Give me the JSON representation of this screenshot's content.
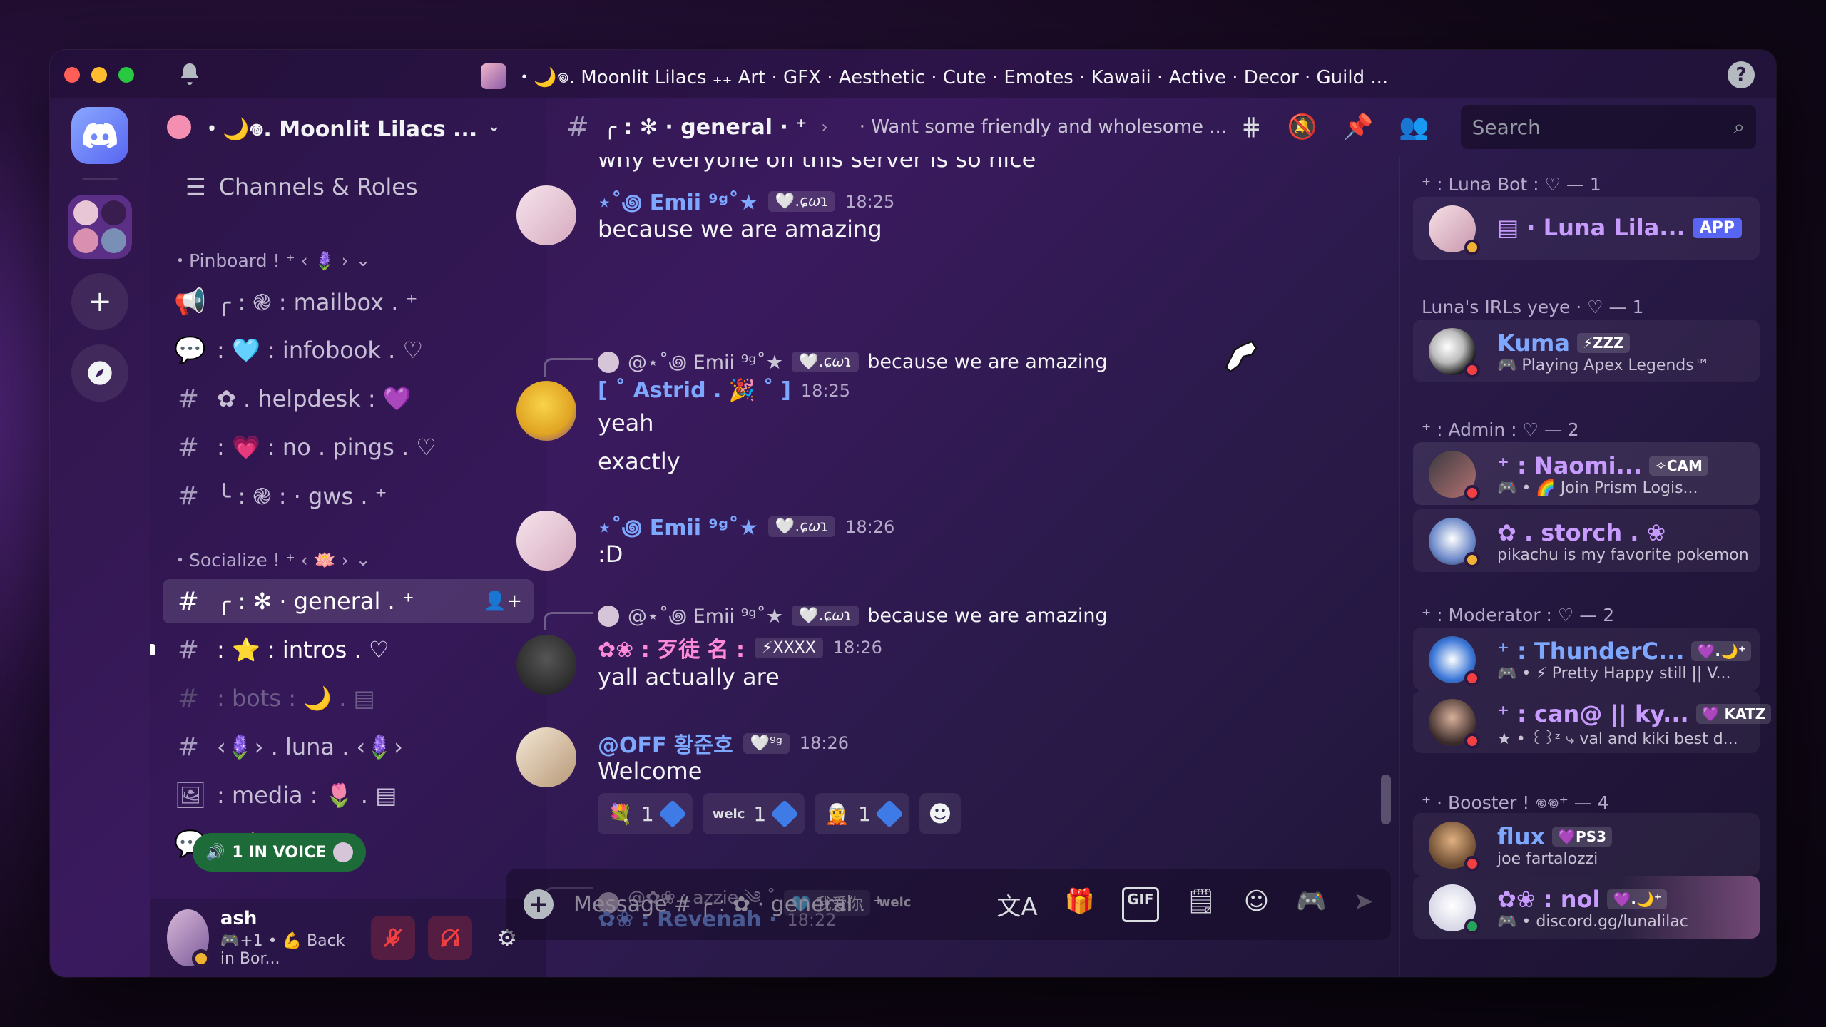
{
  "window": {
    "title": "・🌙𖦹. Moonlit Lilacs ₊₊ Art · GFX · Aesthetic · Cute · Emotes · Kawaii · Active · Decor · Guild ..."
  },
  "server": {
    "name": "・🌙𖦹. Moonlit Lilacs ..."
  },
  "sidebar": {
    "channels_roles": "Channels & Roles",
    "categories": {
      "pinboard": "・Pinboard ! ⁺ ‹ 🪻 ›",
      "socialize": "・Socialize ! ⁺ ‹ 🪷 ›"
    },
    "channels": [
      {
        "hash": "📢",
        "name": "╭ : ֎ : mailbox . ⁺",
        "right": ""
      },
      {
        "hash": "💬",
        "name": ": 🩵 : infobook . ♡",
        "right": ""
      },
      {
        "hash": "#",
        "name": "✿ . helpdesk : 💜",
        "right": ""
      },
      {
        "hash": "#",
        "name": ": 💗 : no . pings . ♡",
        "right": ""
      },
      {
        "hash": "#",
        "name": "╰ : ֎ : · gws . ⁺",
        "right": ""
      },
      {
        "hash": "#",
        "name": "╭ : ✻ · general . ⁺",
        "right": "👤+"
      },
      {
        "hash": "#",
        "name": ": ⭐ : intros . ♡",
        "right": ""
      },
      {
        "hash": "#",
        "name": ": bots : 🌙 . ▤",
        "right": ""
      },
      {
        "hash": "#",
        "name": "‹🪻› . luna . ‹🪻›",
        "right": ""
      },
      {
        "hash": "🖼",
        "name": ": media : 🌷 . ▤",
        "right": ""
      },
      {
        "hash": "💬",
        "name": ": 🌙",
        "right": ""
      }
    ],
    "voice_pill": "1 IN VOICE"
  },
  "user_panel": {
    "name": "ash",
    "status": "🎮+1 • 💪 Back in Bor..."
  },
  "chat_header": {
    "channel": "╭ : ✻ · general · ⁺",
    "topic": "· Want some friendly and wholesome ..."
  },
  "search": {
    "placeholder": "Search"
  },
  "messages": {
    "cutoff": "why everyone on this server is so nice",
    "m1": {
      "name": "⋆˚꩜ Emii ⁹ᵍ˚★",
      "tag": "🤍.ɕ𝜔ɿ",
      "time": "18:25",
      "text": "because we are amazing"
    },
    "m2": {
      "reply_name": "@⋆˚꩜ Emii ⁹ᵍ˚★",
      "reply_tag": "🤍.ɕ𝜔ɿ",
      "reply_text": "because we are amazing",
      "name": "[ ˚ Astrid . 🎉 ˚ ]",
      "time": "18:25",
      "line1": "yeah",
      "line2": "exactly"
    },
    "m3": {
      "name": "⋆˚꩜ Emii ⁹ᵍ˚★",
      "tag": "🤍.ɕ𝜔ɿ",
      "time": "18:26",
      "text": ":D"
    },
    "m4": {
      "reply_name": "@⋆˚꩜ Emii ⁹ᵍ˚★",
      "reply_tag": "🤍.ɕ𝜔ɿ",
      "reply_text": "because we are amazing",
      "name": "✿❀ : 歹徒 名 :",
      "tag": "⚡XXXX",
      "time": "18:26",
      "text": "yall actually are"
    },
    "m5": {
      "name": "@OFF 황준호",
      "tag": "🤍⁹ᵍ",
      "time": "18:26",
      "text": "Welcome",
      "reactions": [
        {
          "emoji": "💐",
          "count": "1"
        },
        {
          "emoji": "welc",
          "count": "1"
        },
        {
          "emoji": "🧝",
          "count": "1"
        }
      ]
    },
    "m6": {
      "reply_name": "@✿❀ : azzie ༄ ˚",
      "reply_tag": "🩵 我爱你",
      "reply_text": "welc",
      "name": "✿❀ : Revenah ·",
      "time": "18:22"
    }
  },
  "composer": {
    "placeholder": "Message # ╭ : ✿ · general . ⁺"
  },
  "members": {
    "roles": [
      {
        "label": "⁺ : Luna Bot : ♡ — 1"
      },
      {
        "label": "Luna's IRLs yeye · ♡ — 1"
      },
      {
        "label": "⁺ : Admin : ♡ — 2"
      },
      {
        "label": "⁺ : Moderator : ♡ — 2"
      },
      {
        "label": "⁺ · Booster ! 𖦹𖦹⁺ — 4"
      }
    ],
    "list": [
      {
        "name": "▤ · Luna Lila...",
        "tag": "APP",
        "sub": ""
      },
      {
        "name": "Kuma",
        "tag": "⚡ZZZ",
        "sub": "🎮 Playing Apex Legends™"
      },
      {
        "name": "⁺ : Naomi...",
        "tag": "✧CAM",
        "sub": "🎮 • 🌈 Join Prism Logis..."
      },
      {
        "name": "✿ . storch . ❀",
        "tag": "",
        "sub": "pikachu is my favorite pokemon"
      },
      {
        "name": "⁺ : ThunderC...",
        "tag": "💜.🌙⁺",
        "sub": "🎮 • ⚡ Pretty Happy still || V..."
      },
      {
        "name": "⁺ : can@ || ky...",
        "tag": "💜 KATZ",
        "sub": "★ • ꒰꒱ᶻ ⤷ val and kiki best d..."
      },
      {
        "name": "flux",
        "tag": "💜PS3",
        "sub": "joe fartalozzi"
      },
      {
        "name": "✿❀ : nol",
        "tag": "💜.🌙⁺",
        "sub": "🎮 • discord.gg/lunalilac"
      }
    ]
  },
  "colors": {
    "accent": "#5865f2",
    "link_blue": "#7ea8ff",
    "purple": "#c89cff",
    "pink": "#ff8ad8"
  }
}
